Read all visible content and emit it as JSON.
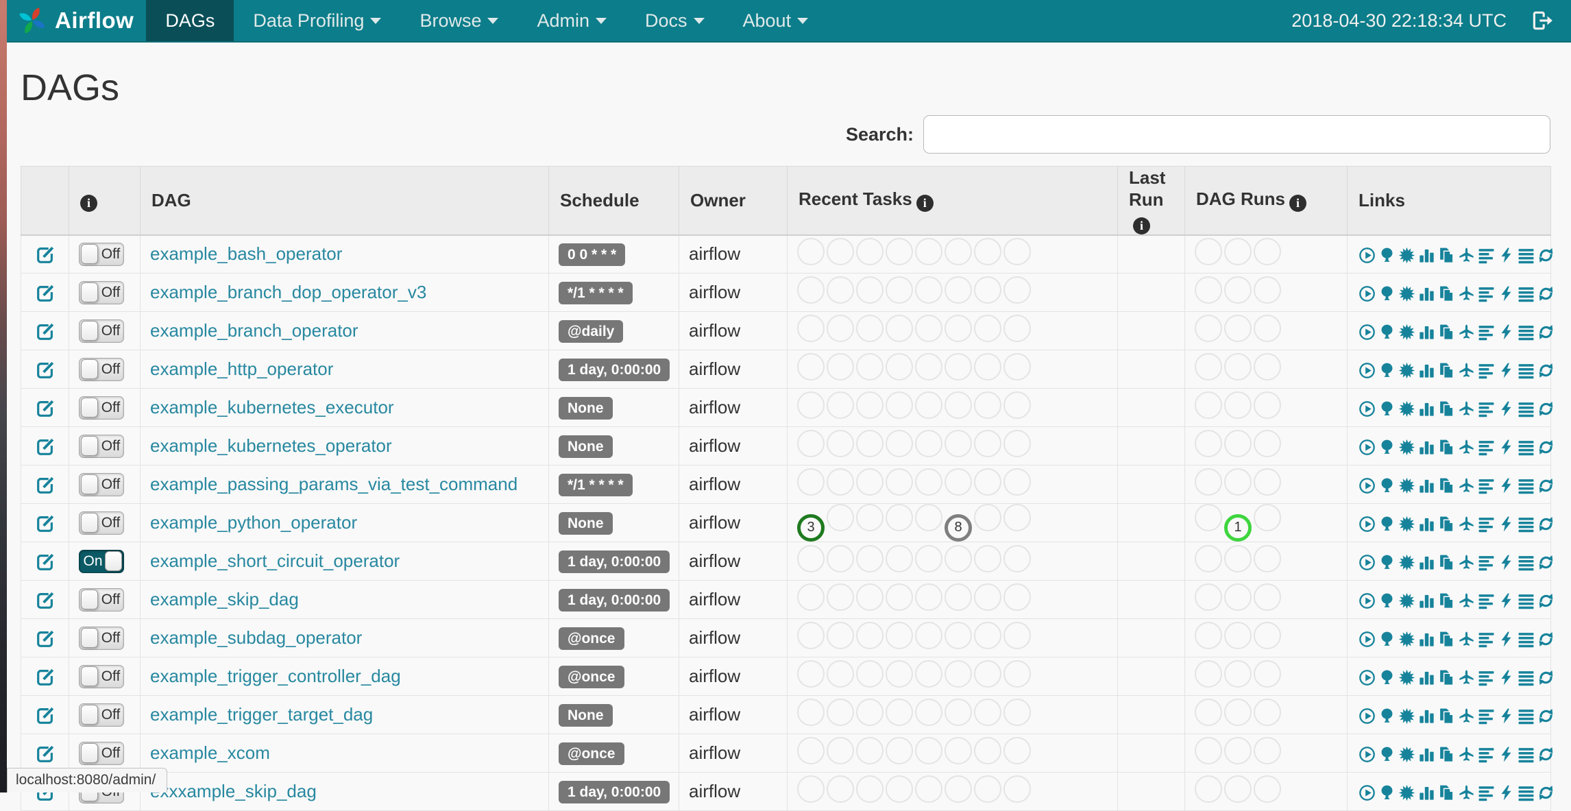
{
  "navbar": {
    "brand": "Airflow",
    "items": [
      {
        "label": "DAGs",
        "active": true,
        "caret": false
      },
      {
        "label": "Data Profiling",
        "active": false,
        "caret": true
      },
      {
        "label": "Browse",
        "active": false,
        "caret": true
      },
      {
        "label": "Admin",
        "active": false,
        "caret": true
      },
      {
        "label": "Docs",
        "active": false,
        "caret": true
      },
      {
        "label": "About",
        "active": false,
        "caret": true
      }
    ],
    "clock": "2018-04-30 22:18:34 UTC"
  },
  "page": {
    "title": "DAGs",
    "search_label": "Search:",
    "search_value": ""
  },
  "table": {
    "headers": {
      "dag": "DAG",
      "schedule": "Schedule",
      "owner": "Owner",
      "recent_tasks": "Recent Tasks",
      "last_run": "Last Run",
      "dag_runs": "DAG Runs",
      "links": "Links"
    },
    "recent_task_slots": 8,
    "dag_run_slots": 3,
    "links": [
      "trigger-dag",
      "tree-view",
      "graph-view",
      "task-duration",
      "task-tries",
      "landing-times",
      "gantt-view",
      "code-view",
      "logs",
      "refresh"
    ]
  },
  "colors": {
    "navbar": "#0c7d8a",
    "navbar_active": "#0a4f58",
    "link": "#2888a0",
    "icon": "#17839b",
    "badge": "#777777",
    "task_success": "#1f7a1f",
    "task_no_status": "#7f7f7f",
    "dagrun_running": "#3ed53e"
  },
  "dags": [
    {
      "name": "example_bash_operator",
      "toggle": {
        "label": "Off",
        "state": "off"
      },
      "schedule": "0 0 * * *",
      "owner": "airflow",
      "last_run": "",
      "recent_tasks": [],
      "dag_runs": []
    },
    {
      "name": "example_branch_dop_operator_v3",
      "toggle": {
        "label": "Off",
        "state": "off"
      },
      "schedule": "*/1 * * * *",
      "owner": "airflow",
      "last_run": "",
      "recent_tasks": [],
      "dag_runs": []
    },
    {
      "name": "example_branch_operator",
      "toggle": {
        "label": "Off",
        "state": "off"
      },
      "schedule": "@daily",
      "owner": "airflow",
      "last_run": "",
      "recent_tasks": [],
      "dag_runs": []
    },
    {
      "name": "example_http_operator",
      "toggle": {
        "label": "Off",
        "state": "off"
      },
      "schedule": "1 day, 0:00:00",
      "owner": "airflow",
      "last_run": "",
      "recent_tasks": [],
      "dag_runs": []
    },
    {
      "name": "example_kubernetes_executor",
      "toggle": {
        "label": "Off",
        "state": "off"
      },
      "schedule": "None",
      "owner": "airflow",
      "last_run": "",
      "recent_tasks": [],
      "dag_runs": []
    },
    {
      "name": "example_kubernetes_operator",
      "toggle": {
        "label": "Off",
        "state": "off"
      },
      "schedule": "None",
      "owner": "airflow",
      "last_run": "",
      "recent_tasks": [],
      "dag_runs": []
    },
    {
      "name": "example_passing_params_via_test_command",
      "toggle": {
        "label": "Off",
        "state": "off"
      },
      "schedule": "*/1 * * * *",
      "owner": "airflow",
      "last_run": "",
      "recent_tasks": [],
      "dag_runs": []
    },
    {
      "name": "example_python_operator",
      "toggle": {
        "label": "Off",
        "state": "off"
      },
      "schedule": "None",
      "owner": "airflow",
      "last_run": "",
      "recent_tasks": [
        {
          "slot": 0,
          "count": 3,
          "state": "success"
        },
        {
          "slot": 5,
          "count": 8,
          "state": "no_status"
        }
      ],
      "dag_runs": [
        {
          "slot": 1,
          "count": 1,
          "state": "running"
        }
      ]
    },
    {
      "name": "example_short_circuit_operator",
      "toggle": {
        "label": "On",
        "state": "on"
      },
      "schedule": "1 day, 0:00:00",
      "owner": "airflow",
      "last_run": "",
      "recent_tasks": [],
      "dag_runs": []
    },
    {
      "name": "example_skip_dag",
      "toggle": {
        "label": "Off",
        "state": "off"
      },
      "schedule": "1 day, 0:00:00",
      "owner": "airflow",
      "last_run": "",
      "recent_tasks": [],
      "dag_runs": []
    },
    {
      "name": "example_subdag_operator",
      "toggle": {
        "label": "Off",
        "state": "off"
      },
      "schedule": "@once",
      "owner": "airflow",
      "last_run": "",
      "recent_tasks": [],
      "dag_runs": []
    },
    {
      "name": "example_trigger_controller_dag",
      "toggle": {
        "label": "Off",
        "state": "off"
      },
      "schedule": "@once",
      "owner": "airflow",
      "last_run": "",
      "recent_tasks": [],
      "dag_runs": []
    },
    {
      "name": "example_trigger_target_dag",
      "toggle": {
        "label": "Off",
        "state": "off"
      },
      "schedule": "None",
      "owner": "airflow",
      "last_run": "",
      "recent_tasks": [],
      "dag_runs": []
    },
    {
      "name": "example_xcom",
      "toggle": {
        "label": "Off",
        "state": "off"
      },
      "schedule": "@once",
      "owner": "airflow",
      "last_run": "",
      "recent_tasks": [],
      "dag_runs": []
    },
    {
      "name": "exxxample_skip_dag",
      "toggle": {
        "label": "Off",
        "state": "off"
      },
      "schedule": "1 day, 0:00:00",
      "owner": "airflow",
      "last_run": "",
      "recent_tasks": [],
      "dag_runs": []
    }
  ],
  "status_bar": "localhost:8080/admin/"
}
